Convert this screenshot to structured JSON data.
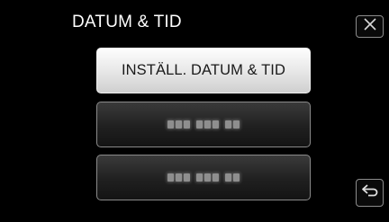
{
  "header": {
    "title": "DATUM & TID"
  },
  "menu": {
    "items": [
      {
        "label": "INSTÄLL. DATUM & TID",
        "state": "selected"
      },
      {
        "label": "",
        "state": "obscured"
      },
      {
        "label": "",
        "state": "obscured"
      }
    ]
  },
  "icons": {
    "close": "close-icon",
    "back": "back-return-icon"
  },
  "colors": {
    "background": "#000000",
    "selected_button": "#eeeeee",
    "button": "#262626",
    "border": "#8a8a8a"
  }
}
